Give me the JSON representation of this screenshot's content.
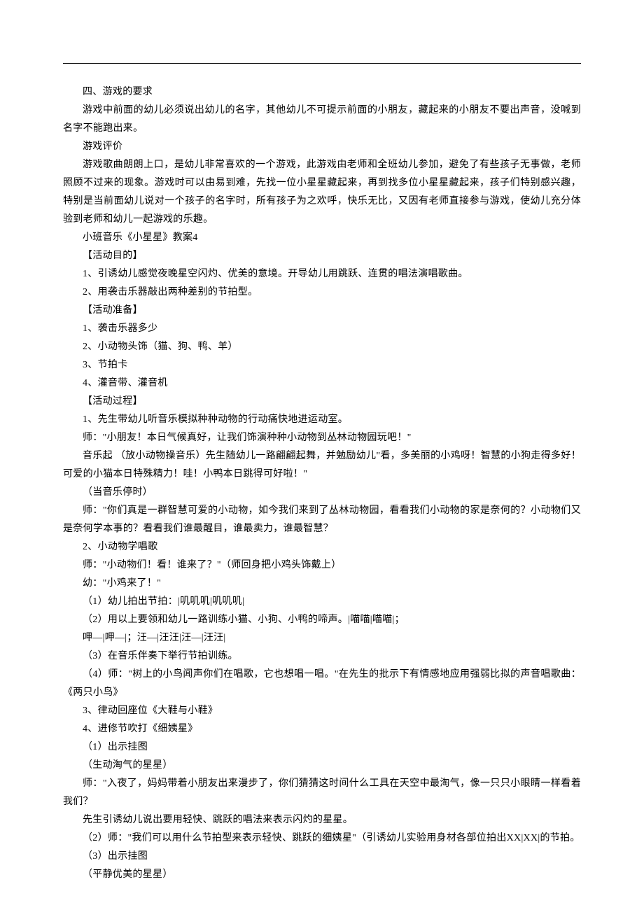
{
  "paragraphs": [
    "四、游戏的要求",
    "游戏中前面的幼儿必须说出幼儿的名字，其他幼儿不可提示前面的小朋友，藏起来的小朋友不要出声音，没喊到名字不能跑出来。",
    "游戏评价",
    "游戏歌曲朗朗上口，是幼儿非常喜欢的一个游戏，此游戏由老师和全班幼儿参加，避免了有些孩子无事做，老师照顾不过来的现象。游戏时可以由易到难，先找一位小星星藏起来，再到找多位小星星藏起来，孩子们特别感兴趣，特别是当前面幼儿说对一个孩子的名字时，所有孩子为之欢呼，快乐无比，又因有老师直接参与游戏，使幼儿充分体验到老师和幼儿一起游戏的乐趣。",
    "小班音乐《小星星》教案4",
    "【活动目的】",
    "1、引诱幼儿感觉夜晚星空闪灼、优美的意境。开导幼儿用跳跃、连贯的唱法演唱歌曲。",
    "2、用袭击乐器敲出两种差别的节拍型。",
    "【活动准备】",
    "1、袭击乐器多少",
    "2、小动物头饰（猫、狗、鸭、羊）",
    "3、节拍卡",
    "4、灌音带、灌音机",
    "【活动过程】",
    "1、先生带幼儿听音乐模拟种种动物的行动痛快地进运动室。",
    "师：\"小朋友！本日气候真好，让我们饰演种种小动物到丛林动物园玩吧！\"",
    "音乐起 （放小动物操音乐）先生随幼儿一路翩翩起舞，并勉励幼儿\"看，多美丽的小鸡呀！智慧的小狗走得多好！可爱的小猫本日特殊精力！哇！小鸭本日跳得可好啦！\"",
    "（当音乐停时）",
    "师：\"你们真是一群智慧可爱的小动物，如今我们来到了丛林动物园，看看我们小动物的家是奈何的？小动物们又是奈何学本事的？看看我们谁最醒目，谁最卖力，谁最智慧？",
    "2、小动物学唱歌",
    "师：\"小动物们！看！谁来了？\"（师回身把小鸡头饰戴上）",
    "幼：\"小鸡来了！\"",
    "（1）幼儿拍出节拍：|叽叽叽|叽叽叽|",
    "（2）用以上要领和幼儿一路训练小猫、小狗、小鸭的啼声。|喵喵|喵喵|；",
    "呷—|呷—|；汪—|汪汪|汪—|汪汪|",
    "（3）在音乐伴奏下举行节拍训练。",
    "（4）师：\"树上的小鸟闻声你们在唱歌，它也想唱一唱。\"在先生的批示下有情感地应用强弱比拟的声音唱歌曲：《两只小鸟》",
    "3、律动回座位《大鞋与小鞋》",
    "4、进修节吹打《细姨星》",
    "（1）出示挂图",
    "（生动淘气的星星）",
    "师：\"入夜了，妈妈带着小朋友出来漫步了，你们猜猜这时间什么工具在天空中最淘气，像一只只小眼睛一样看着我们？",
    "先生引诱幼儿说出要用轻快、跳跃的唱法来表示闪灼的星星。",
    "（2）师：\"我们可以用什么节拍型来表示轻快、跳跃的细姨星\"（引诱幼儿实验用身材各部位拍出XX|XX|的节拍。",
    "（3）出示挂图",
    "（平静优美的星星）"
  ]
}
